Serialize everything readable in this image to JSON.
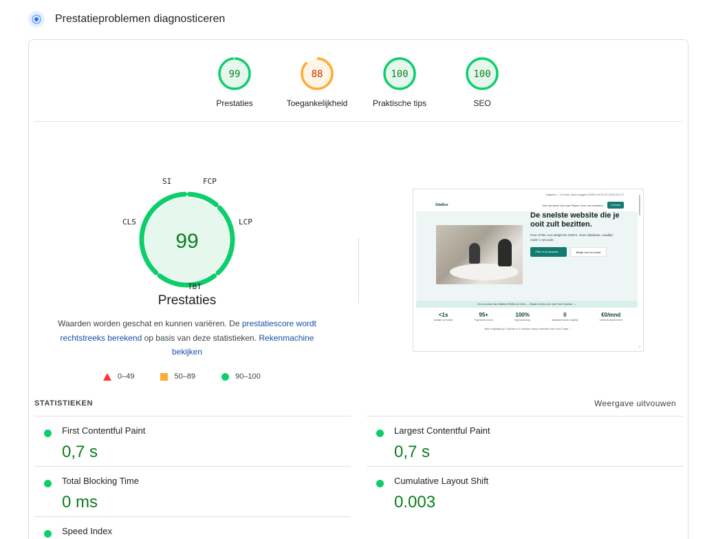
{
  "header": {
    "title": "Prestatieproblemen diagnosticeren",
    "icon": "lighthouse-icon"
  },
  "gauges": [
    {
      "score": "99",
      "label": "Prestaties",
      "color": "#0cce6b",
      "fill": "#e6f8ee",
      "text": "#0d7d1f",
      "fraction": 0.99
    },
    {
      "score": "88",
      "label": "Toegankelijkheid",
      "color": "#ffaa33",
      "fill": "#fff5e6",
      "text": "#c33300",
      "fraction": 0.88
    },
    {
      "score": "100",
      "label": "Praktische tips",
      "color": "#0cce6b",
      "fill": "#e6f8ee",
      "text": "#0d7d1f",
      "fraction": 1.0
    },
    {
      "score": "100",
      "label": "SEO",
      "color": "#0cce6b",
      "fill": "#e6f8ee",
      "text": "#0d7d1f",
      "fraction": 1.0
    }
  ],
  "main_gauge": {
    "score": "99",
    "title": "Prestaties",
    "metrics": [
      "SI",
      "FCP",
      "LCP",
      "TBT",
      "CLS"
    ],
    "color": "#0cce6b",
    "fill": "#e6f8ee"
  },
  "description": {
    "text1": "Waarden worden geschat en kunnen variëren. De ",
    "link1": "prestatiescore wordt rechtstreeks berekend",
    "text2": " op basis van deze statistieken. ",
    "link2": "Rekenmachine bekijken"
  },
  "legend": [
    {
      "range": "0–49",
      "color": "#ff3333"
    },
    {
      "range": "50–89",
      "color": "#ffaa33"
    },
    {
      "range": "90–100",
      "color": "#0cce6b"
    }
  ],
  "thumbnail": {
    "topbar": "Intigrant — Je thuis, klaar zeggen   #1300 al   KTA 40 (015) 011 07",
    "logo": "SiteBox",
    "nav": "Hoe het werkt   Voor wie   Prijzen   Over ons   Inzichten",
    "nav_button": "Contact",
    "headline": "De snelste website die je ooit zult bezitten.",
    "subline": "Pure HTML voor Belgische KMO's. Geen database. Laadtijd onder 1 seconde.",
    "cta1": "Plan nu je gesprek →",
    "cta2": "Bekijk hoe het werkt",
    "strip": "Een product van Malbse BVBA uit Gent — Maak kennis met Joel Van Draeme →",
    "stats": [
      {
        "value": "<1s",
        "label": "laadtijd op mobiel"
      },
      {
        "value": "95+",
        "label": "PageSpeed score"
      },
      {
        "value": "100%",
        "label": "eigenaarschap"
      },
      {
        "value": "0",
        "label": "database hacks mogelijk"
      },
      {
        "value": "€0/mnd",
        "label": "verplicht abonnement"
      }
    ],
    "note": "Wat vergelijking? Ontdek in 3 minuten wat je website kost over 5 jaar →"
  },
  "statistics": {
    "heading": "STATISTIEKEN",
    "expand_label": "Weergave uitvouwen",
    "items": [
      {
        "name": "First Contentful Paint",
        "value": "0,7 s"
      },
      {
        "name": "Largest Contentful Paint",
        "value": "0,7 s"
      },
      {
        "name": "Total Blocking Time",
        "value": "0 ms"
      },
      {
        "name": "Cumulative Layout Shift",
        "value": "0.003"
      },
      {
        "name": "Speed Index",
        "value": ""
      }
    ]
  }
}
